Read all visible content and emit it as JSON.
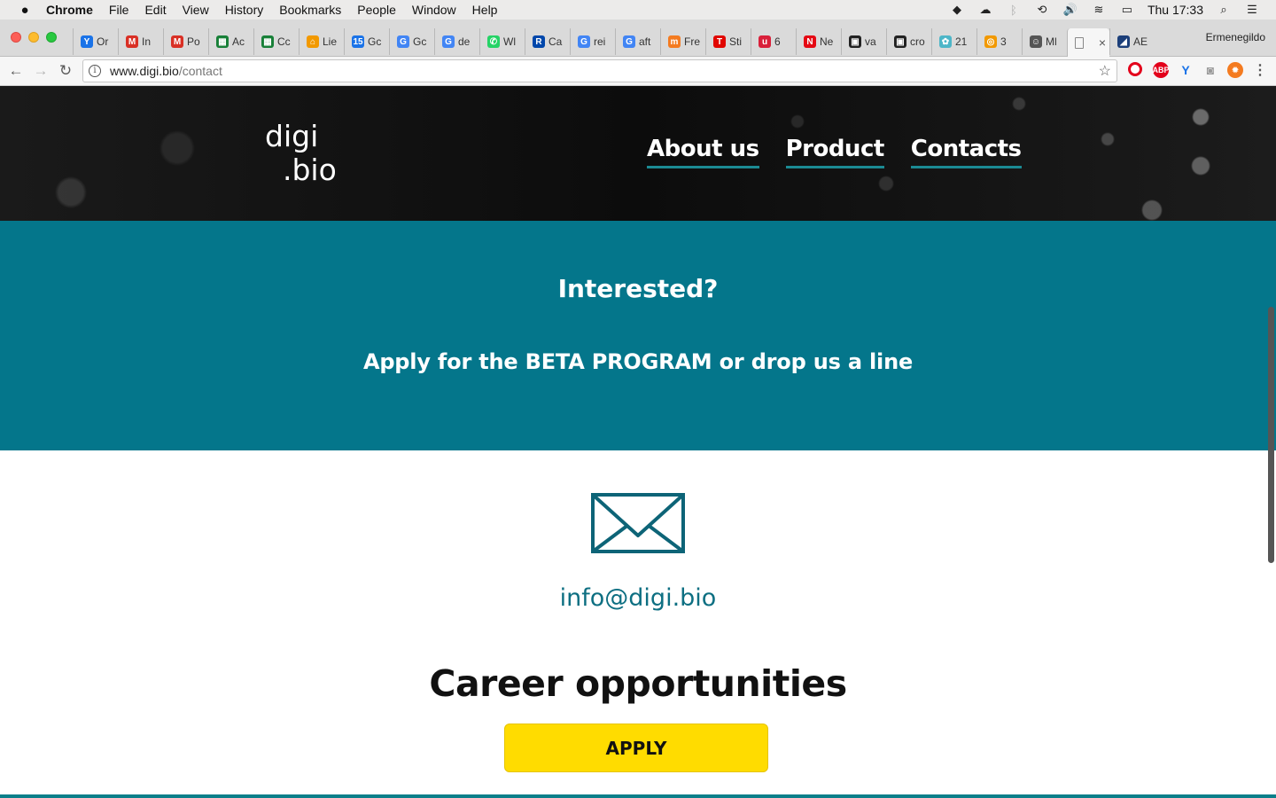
{
  "menubar": {
    "app": "Chrome",
    "items": [
      "File",
      "Edit",
      "View",
      "History",
      "Bookmarks",
      "People",
      "Window",
      "Help"
    ],
    "clock": "Thu 17:33"
  },
  "tabs": [
    {
      "label": "Or",
      "color": "#1a73e8",
      "glyph": "Y"
    },
    {
      "label": "In",
      "color": "#d93025",
      "glyph": "M"
    },
    {
      "label": "Po",
      "color": "#d93025",
      "glyph": "M"
    },
    {
      "label": "Ac",
      "color": "#188038",
      "glyph": "▦"
    },
    {
      "label": "Cc",
      "color": "#188038",
      "glyph": "▦"
    },
    {
      "label": "Lie",
      "color": "#f29900",
      "glyph": "⌂"
    },
    {
      "label": "Gc",
      "color": "#1a73e8",
      "glyph": "15"
    },
    {
      "label": "Gc",
      "color": "#4285f4",
      "glyph": "G"
    },
    {
      "label": "de",
      "color": "#4285f4",
      "glyph": "G"
    },
    {
      "label": "Wl",
      "color": "#25d366",
      "glyph": "✆"
    },
    {
      "label": "Ca",
      "color": "#0047ab",
      "glyph": "R"
    },
    {
      "label": "rei",
      "color": "#4285f4",
      "glyph": "G"
    },
    {
      "label": "aft",
      "color": "#4285f4",
      "glyph": "G"
    },
    {
      "label": "Fre",
      "color": "#f47b20",
      "glyph": "m"
    },
    {
      "label": "Sti",
      "color": "#e10600",
      "glyph": "T"
    },
    {
      "label": "6",
      "color": "#d9203a",
      "glyph": "u"
    },
    {
      "label": "Ne",
      "color": "#e50914",
      "glyph": "N"
    },
    {
      "label": "va",
      "color": "#222222",
      "glyph": "▣"
    },
    {
      "label": "cro",
      "color": "#222222",
      "glyph": "▣"
    },
    {
      "label": "21",
      "color": "#4db6c8",
      "glyph": "✿"
    },
    {
      "label": "3",
      "color": "#f29900",
      "glyph": "◎"
    },
    {
      "label": "Ml",
      "color": "#555555",
      "glyph": "☺"
    },
    {
      "label": "",
      "color": "#888888",
      "glyph": "▯",
      "active": true
    },
    {
      "label": "AE",
      "color": "#1c3f7a",
      "glyph": "◢"
    }
  ],
  "profile_name": "Ermenegildo",
  "address": {
    "host": "www.digi.bio",
    "path": "/contact"
  },
  "site": {
    "logo_line1": "digi",
    "logo_line2": ".bio",
    "nav": [
      "About us",
      "Product",
      "Contacts"
    ],
    "hero_title": "Interested?",
    "hero_subtitle": "Apply for the BETA PROGRAM or drop us a line",
    "email": "info@digi.bio",
    "career_heading": "Career opportunities",
    "apply_label": "APPLY"
  }
}
